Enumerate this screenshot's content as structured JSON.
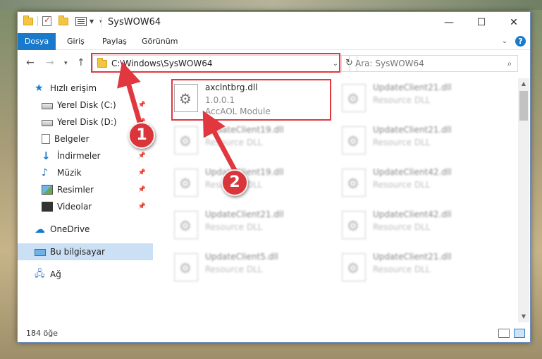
{
  "window": {
    "title": "SysWOW64",
    "controls": {
      "minimize": "—",
      "maximize": "☐",
      "close": "✕"
    }
  },
  "ribbon": {
    "tabs": [
      "Dosya",
      "Giriş",
      "Paylaş",
      "Görünüm"
    ],
    "help": "?"
  },
  "nav": {
    "address": "C:\\Windows\\SysWOW64",
    "search_placeholder": "Ara: SysWOW64"
  },
  "sidebar": {
    "items": [
      {
        "label": "Hızlı erişim",
        "icon": "star-icon",
        "pinned": false
      },
      {
        "label": "Yerel Disk (C:)",
        "icon": "disk-icon",
        "pinned": true
      },
      {
        "label": "Yerel Disk (D:)",
        "icon": "disk-icon",
        "pinned": true
      },
      {
        "label": "Belgeler",
        "icon": "documents-icon",
        "pinned": true
      },
      {
        "label": "İndirmeler",
        "icon": "downloads-icon",
        "pinned": true
      },
      {
        "label": "Müzik",
        "icon": "music-icon",
        "pinned": true
      },
      {
        "label": "Resimler",
        "icon": "pictures-icon",
        "pinned": true
      },
      {
        "label": "Videolar",
        "icon": "videos-icon",
        "pinned": true
      },
      {
        "label": "OneDrive",
        "icon": "cloud-icon",
        "pinned": false
      },
      {
        "label": "Bu bilgisayar",
        "icon": "computer-icon",
        "pinned": false,
        "selected": true
      },
      {
        "label": "Ağ",
        "icon": "network-icon",
        "pinned": false
      }
    ]
  },
  "files": {
    "highlighted": {
      "name": "axclntbrg.dll",
      "version": "1.0.0.1",
      "description": "AccAOL Module"
    },
    "left_column": [
      {
        "name": "UpdateClient19.dll",
        "description": "Resource DLL"
      },
      {
        "name": "UpdateClient19.dll",
        "description": "Resource DLL"
      },
      {
        "name": "UpdateClient21.dll",
        "description": "Resource DLL"
      },
      {
        "name": "UpdateClient5.dll",
        "description": "Resource DLL"
      }
    ],
    "right_column": [
      {
        "name": "UpdateClient21.dll",
        "description": "Resource DLL"
      },
      {
        "name": "UpdateClient21.dll",
        "description": "Resource DLL"
      },
      {
        "name": "UpdateClient42.dll",
        "description": "Resource DLL"
      },
      {
        "name": "UpdateClient42.dll",
        "description": "Resource DLL"
      },
      {
        "name": "UpdateClient21.dll",
        "description": "Resource DLL"
      }
    ]
  },
  "status": {
    "item_count": "184 öğe"
  },
  "callouts": [
    "1",
    "2"
  ],
  "colors": {
    "accent": "#1979ca",
    "highlight_red": "#e0383e",
    "selected_bg": "#cce0f5"
  }
}
